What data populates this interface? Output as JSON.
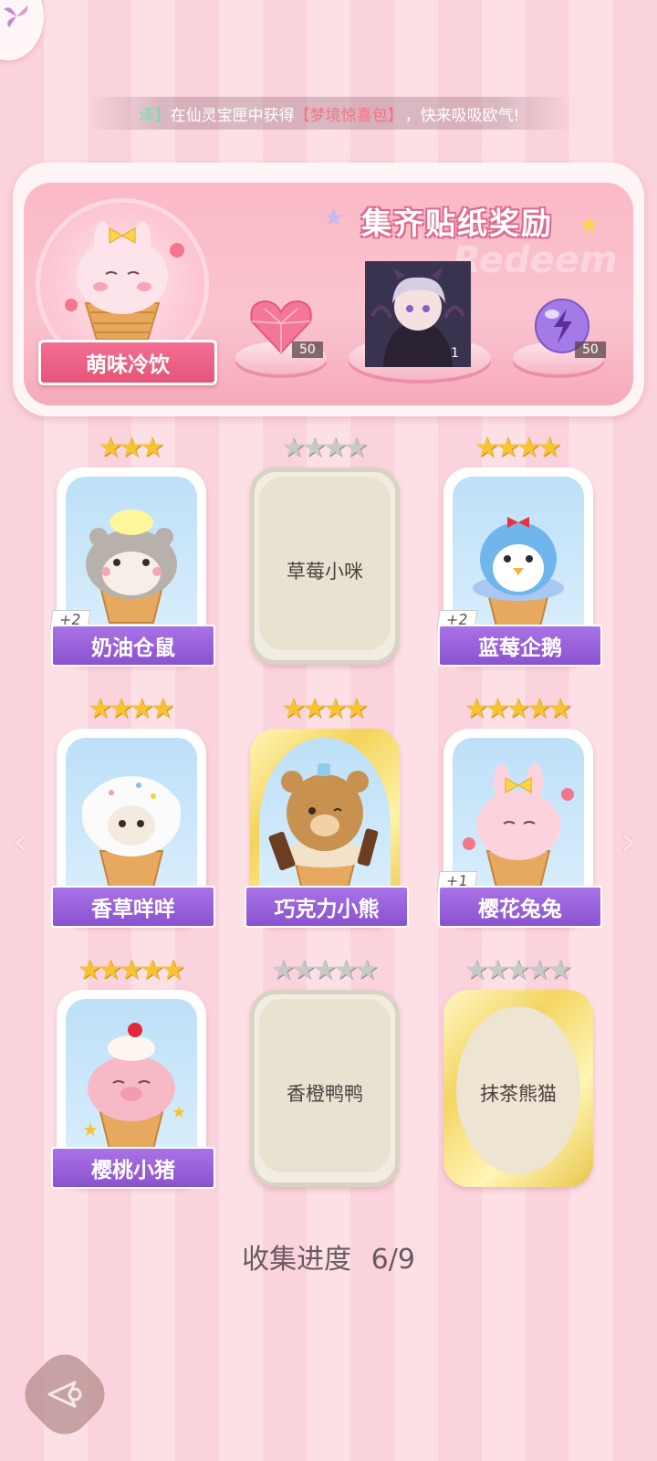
{
  "ticker": {
    "name": "泽】",
    "mid": "在仙灵宝匣中获得",
    "item": "【梦境惊喜包】",
    "tail": "，快来吸吸欧气!"
  },
  "banner": {
    "title": "集齐贴纸奖励",
    "watermark": "Redeem",
    "series_label": "萌味冷饮",
    "rewards": [
      {
        "icon": "pink-heart-gem-icon",
        "count": "50"
      },
      {
        "icon": "character-portrait",
        "count": "1"
      },
      {
        "icon": "purple-energy-orb-icon",
        "count": "50"
      }
    ]
  },
  "cards": [
    {
      "name": "奶油仓鼠",
      "stars": 3,
      "unlocked": true,
      "plus": "+2",
      "style": "blue"
    },
    {
      "name": "草莓小咪",
      "stars": 4,
      "unlocked": false,
      "style": "locked"
    },
    {
      "name": "蓝莓企鹅",
      "stars": 4,
      "unlocked": true,
      "plus": "+2",
      "style": "blue"
    },
    {
      "name": "香草咩咩",
      "stars": 4,
      "unlocked": true,
      "style": "blue"
    },
    {
      "name": "巧克力小熊",
      "stars": 4,
      "unlocked": true,
      "style": "gold"
    },
    {
      "name": "樱花兔兔",
      "stars": 5,
      "unlocked": true,
      "plus": "+1",
      "style": "blue"
    },
    {
      "name": "樱桃小猪",
      "stars": 5,
      "unlocked": true,
      "style": "blue"
    },
    {
      "name": "香橙鸭鸭",
      "stars": 5,
      "unlocked": false,
      "style": "locked"
    },
    {
      "name": "抹茶熊猫",
      "stars": 5,
      "unlocked": false,
      "style": "matcha"
    }
  ],
  "progress": {
    "label": "收集进度",
    "value": "6/9"
  },
  "nav": {
    "left_arrow": "‹",
    "right_arrow": "›"
  },
  "colors": {
    "accent_pink": "#e55479",
    "ribbon_purple": "#8a52cf",
    "star_gold": "#f6c432"
  }
}
